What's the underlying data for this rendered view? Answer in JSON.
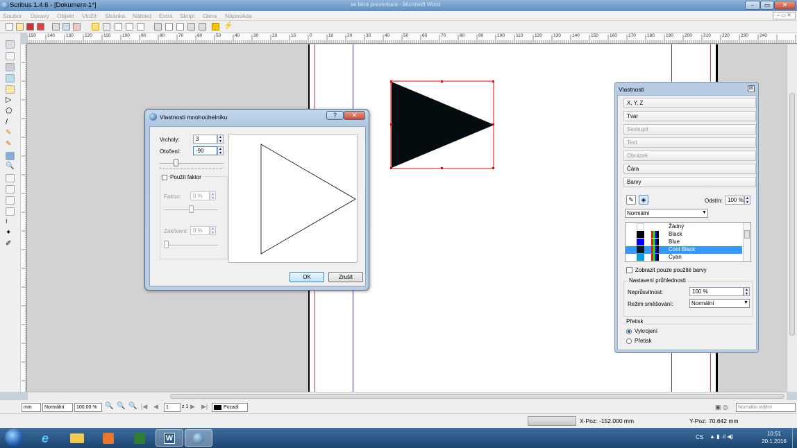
{
  "window": {
    "title": "Scribus 1.4.6 - [Dokument-1*]",
    "bg_title": "se bkra prezentace - Microsoft Word"
  },
  "menu": [
    "Soubor",
    "Úpravy",
    "Objekt",
    "Vložit",
    "Stránka",
    "Náhled",
    "Extra",
    "Skript",
    "Okna",
    "Nápověda"
  ],
  "ruler_labels": [
    "150",
    "140",
    "130",
    "120",
    "110",
    "100",
    "90",
    "80",
    "70",
    "60",
    "50",
    "40",
    "30",
    "20",
    "10",
    "0",
    "10",
    "20",
    "30",
    "40",
    "50",
    "60",
    "70",
    "80",
    "90",
    "100",
    "110",
    "120",
    "130",
    "140",
    "150",
    "160",
    "170",
    "180",
    "190",
    "200",
    "210",
    "220",
    "230",
    "240"
  ],
  "dialog": {
    "title": "Vlastnosti mnohoúhelníku",
    "help": "?",
    "close": "✕",
    "vrcholy_label": "Vrcholy:",
    "vrcholy_value": "3",
    "otoceni_label": "Otočení:",
    "otoceni_value": "-90",
    "pouzit_faktor": "Použít faktor",
    "faktor_label": "Faktor:",
    "faktor_value": "0 %",
    "zakriveni_label": "Zakřivení:",
    "zakriveni_value": "0 %",
    "ok": "OK",
    "zrusit": "Zrušit"
  },
  "props": {
    "title": "Vlastnosti",
    "sections": [
      {
        "label": "X, Y, Z",
        "enabled": true
      },
      {
        "label": "Tvar",
        "enabled": true
      },
      {
        "label": "Seskupit",
        "enabled": false
      },
      {
        "label": "Text",
        "enabled": false
      },
      {
        "label": "Obrázek",
        "enabled": false
      },
      {
        "label": "Čára",
        "enabled": true
      },
      {
        "label": "Barvy",
        "enabled": true
      }
    ],
    "odstin_label": "Odstín:",
    "odstin_value": "100 %",
    "mode_value": "Normální",
    "colors": [
      {
        "name": "Žádný",
        "color": "#ffffff"
      },
      {
        "name": "Black",
        "color": "#000000"
      },
      {
        "name": "Blue",
        "color": "#0000ff"
      },
      {
        "name": "Cool Black",
        "color": "#0a1a22"
      },
      {
        "name": "Cyan",
        "color": "#00a0e0"
      }
    ],
    "selected_color": "Cool Black",
    "only_used": "Zobrazit pouze použité barvy",
    "transparency_header": "Nastavení průhlednosti",
    "opacity_label": "Neprůsvitnost:",
    "opacity_value": "100 %",
    "blend_label": "Režim směšování:",
    "blend_value": "Normální",
    "pretisk_header": "Přetisk",
    "knockout": "Vykrojení",
    "overprint": "Přetisk"
  },
  "status": {
    "unit": "mm",
    "mode": "Normální",
    "zoom": "100.00 %",
    "page": "1",
    "page_of": "z 1",
    "layer": "Pozadí",
    "view": "Normální vidění"
  },
  "coords": {
    "xpoz_label": "X-Poz:",
    "xpoz": "-152.000 mm",
    "ypoz_label": "Y-Poz:",
    "ypoz": "70.642 mm"
  },
  "tray": {
    "lang": "CS",
    "time": "10:51",
    "date": "20.1.2016"
  }
}
